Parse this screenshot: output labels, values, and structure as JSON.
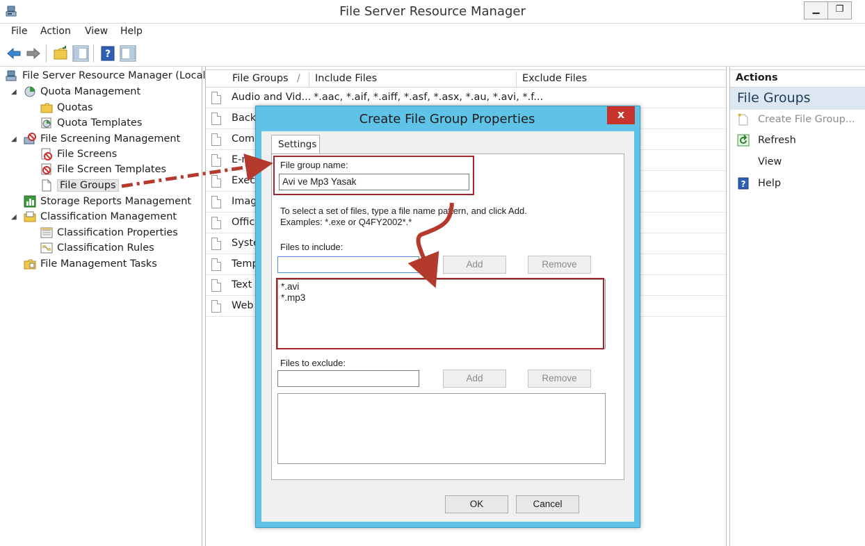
{
  "window": {
    "title": "File Server Resource Manager"
  },
  "menu": [
    "File",
    "Action",
    "View",
    "Help"
  ],
  "toolbar": {
    "icons": [
      "back-arrow-icon",
      "forward-arrow-icon",
      "up-folder-icon",
      "show-hide-tree-icon",
      "help-icon",
      "show-hide-action-pane-icon"
    ]
  },
  "tree": {
    "root": "File Server Resource Manager (Local)",
    "items": [
      {
        "label": "Quota Management",
        "icon": "quota-icon"
      },
      {
        "label": "Quotas",
        "icon": "folder-icon"
      },
      {
        "label": "Quota Templates",
        "icon": "template-icon"
      },
      {
        "label": "File Screening Management",
        "icon": "screening-icon"
      },
      {
        "label": "File Screens",
        "icon": "blocked-icon"
      },
      {
        "label": "File Screen Templates",
        "icon": "blocked-template-icon"
      },
      {
        "label": "File Groups",
        "icon": "document-icon"
      },
      {
        "label": "Storage Reports Management",
        "icon": "report-icon"
      },
      {
        "label": "Classification Management",
        "icon": "classification-icon"
      },
      {
        "label": "Classification Properties",
        "icon": "properties-icon"
      },
      {
        "label": "Classification Rules",
        "icon": "rules-icon"
      },
      {
        "label": "File Management Tasks",
        "icon": "tasks-folder-icon"
      }
    ]
  },
  "list": {
    "columns": [
      "File Groups",
      "Include Files",
      "Exclude Files"
    ],
    "sort_glyph": "/",
    "rows": [
      {
        "name": "Audio and Vid...",
        "include": "*.aac, *.aif, *.aiff, *.asf, *.asx, *.au, *.avi, *.f..."
      },
      {
        "name": "Back",
        "include": ""
      },
      {
        "name": "Com",
        "include": ""
      },
      {
        "name": "E-ma",
        "include": ""
      },
      {
        "name": "Execu",
        "include": ""
      },
      {
        "name": "Imag",
        "include": ""
      },
      {
        "name": "Offic",
        "include": ""
      },
      {
        "name": "Syste",
        "include": ""
      },
      {
        "name": "Temp",
        "include": ""
      },
      {
        "name": "Text",
        "include": ""
      },
      {
        "name": "Web",
        "include": ""
      }
    ]
  },
  "actions": {
    "header": "Actions",
    "section": "File Groups",
    "items": [
      {
        "label": "Create File Group...",
        "disabled": true
      },
      {
        "label": "Refresh",
        "disabled": false
      },
      {
        "label": "View",
        "disabled": false
      },
      {
        "label": "Help",
        "disabled": false
      }
    ]
  },
  "dialog": {
    "title": "Create File Group Properties",
    "close_glyph": "x",
    "tab": "Settings",
    "group_name_label": "File group name:",
    "group_name_value": "Avi ve Mp3 Yasak",
    "instructions_line1": "To select a set of files, type a file name pattern, and click Add.",
    "instructions_line2": "Examples: *.exe or Q4FY2002*.*",
    "include_label": "Files to include:",
    "include_input": "",
    "include_list": [
      "*.avi",
      "*.mp3"
    ],
    "exclude_label": "Files to exclude:",
    "exclude_input": "",
    "exclude_list": [],
    "add_label": "Add",
    "remove_label": "Remove",
    "ok_label": "OK",
    "cancel_label": "Cancel"
  },
  "colors": {
    "dialog_frame": "#5fc3e8",
    "highlight": "#a2262d",
    "arrow": "#b53a2e",
    "close_button": "#c8342c",
    "actions_section": "#dce7f2"
  }
}
